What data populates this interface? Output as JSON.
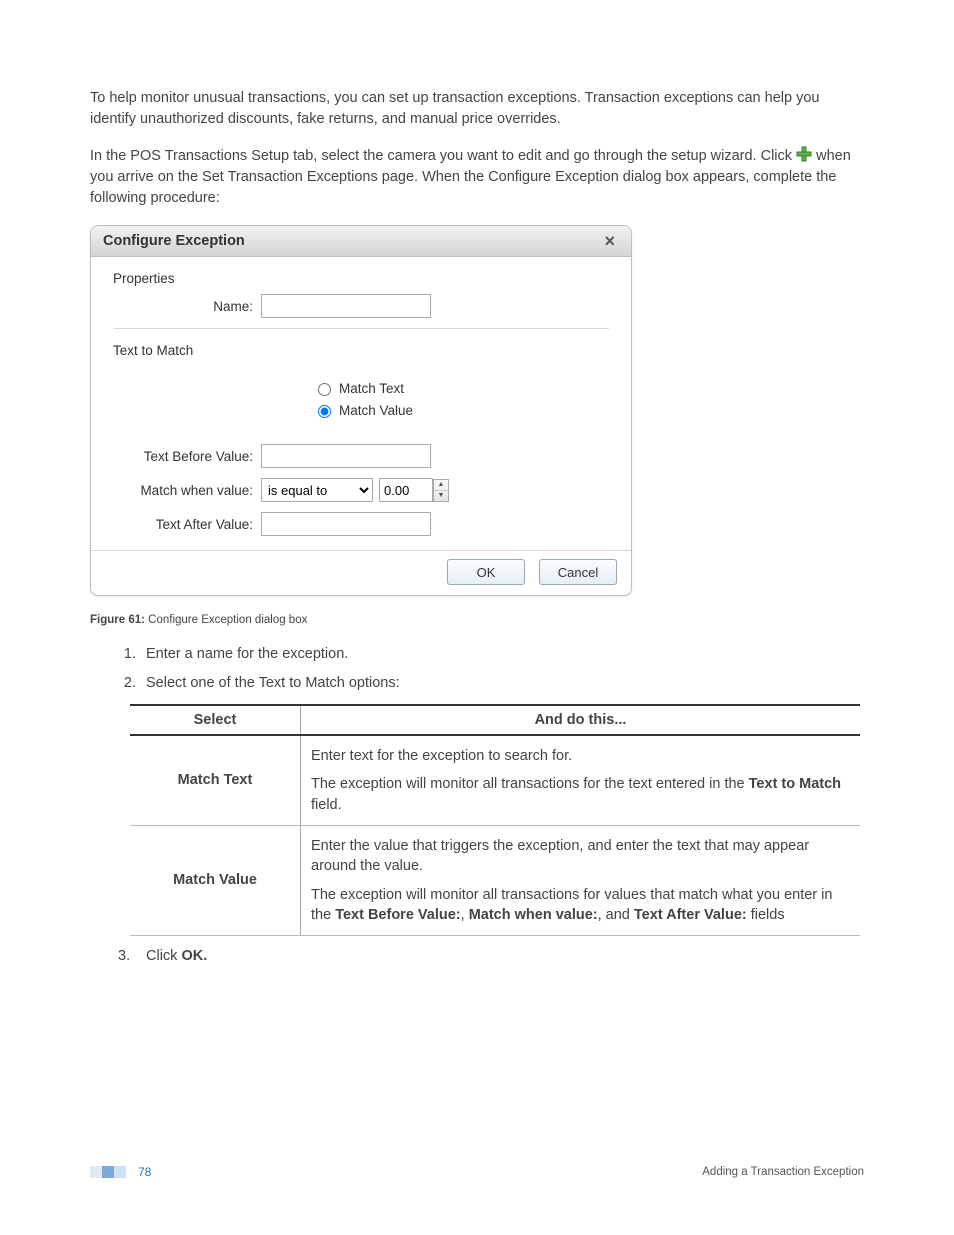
{
  "intro": {
    "para1": "To help monitor unusual transactions, you can set up transaction exceptions. Transaction exceptions can help you identify unauthorized discounts, fake returns, and manual price overrides.",
    "para2_a": "In the POS Transactions Setup tab, select the camera you want to edit and go through the setup wizard. Click ",
    "para2_b": " when you arrive on the Set Transaction Exceptions page. When the Configure Exception dialog box appears, complete the following procedure:"
  },
  "dialog": {
    "title": "Configure Exception",
    "close_glyph": "×",
    "sections": {
      "properties": "Properties",
      "text_to_match": "Text to Match"
    },
    "labels": {
      "name": "Name:",
      "match_text": "Match Text",
      "match_value": "Match Value",
      "text_before": "Text Before Value:",
      "match_when": "Match when value:",
      "text_after": "Text After Value:"
    },
    "match_select": "is equal to",
    "match_num": "0.00",
    "buttons": {
      "ok": "OK",
      "cancel": "Cancel"
    }
  },
  "figure": {
    "label": "Figure 61:",
    "caption": " Configure Exception dialog box"
  },
  "steps": {
    "s1": "Enter a name for the exception.",
    "s2": "Select one of the Text to Match options:",
    "s3_a": "Click ",
    "s3_b": "OK."
  },
  "table": {
    "head": {
      "select": "Select",
      "and_do": "And do this..."
    },
    "rows": [
      {
        "select": "Match Text",
        "p1": "Enter text for the exception to search for.",
        "p2_a": "The exception will monitor all transactions for the text entered in the ",
        "p2_bold": "Text to Match",
        "p2_b": " field."
      },
      {
        "select": "Match Value",
        "p1": "Enter the value that triggers the exception, and enter the text that may appear around the value.",
        "p2_a": "The exception will monitor all transactions for values that match what you enter in the ",
        "p2_bold1": "Text Before Value:",
        "p2_mid1": ", ",
        "p2_bold2": "Match when value:",
        "p2_mid2": ", and ",
        "p2_bold3": "Text After Value:",
        "p2_b": " fields"
      }
    ]
  },
  "footer": {
    "page_num": "78",
    "section_title": "Adding a Transaction Exception"
  }
}
